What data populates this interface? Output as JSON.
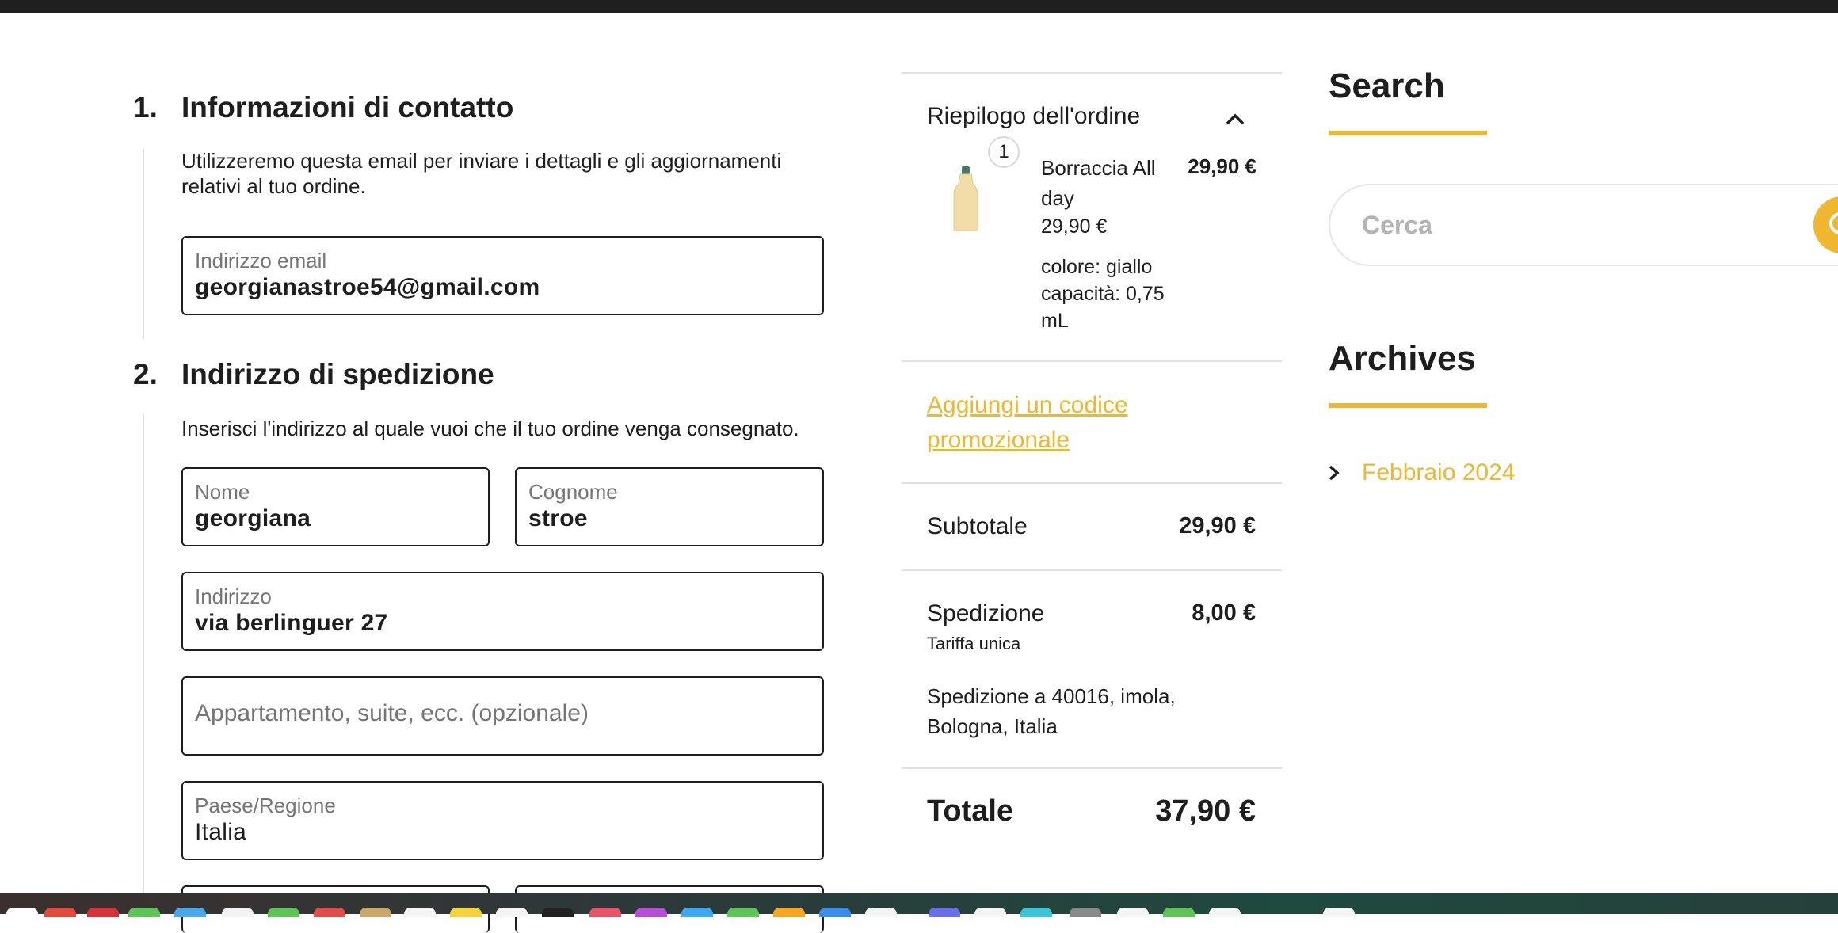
{
  "checkout": {
    "step1": {
      "number": "1.",
      "title": "Informazioni di contatto",
      "description": "Utilizzeremo questa email per inviare i dettagli e gli aggiornamenti relativi al tuo ordine.",
      "email": {
        "label": "Indirizzo email",
        "value": "georgianastroe54@gmail.com"
      }
    },
    "step2": {
      "number": "2.",
      "title": "Indirizzo di spedizione",
      "description": "Inserisci l'indirizzo al quale vuoi che il tuo ordine venga consegnato.",
      "first_name": {
        "label": "Nome",
        "value": "georgiana"
      },
      "last_name": {
        "label": "Cognome",
        "value": "stroe"
      },
      "address": {
        "label": "Indirizzo",
        "value": "via berlinguer 27"
      },
      "address2": {
        "placeholder": "Appartamento, suite, ecc. (opzionale)"
      },
      "country": {
        "label": "Paese/Regione",
        "value": "Italia"
      }
    }
  },
  "summary": {
    "heading": "Riepilogo dell'ordine",
    "item": {
      "quantity": "1",
      "name": "Borraccia All day",
      "line_total": "29,90 €",
      "unit_price": "29,90 €",
      "color": "colore: giallo",
      "capacity": "capacità: 0,75 mL",
      "thumb_color": "#f2dca8"
    },
    "promo_link": "Aggiungi un codice promozionale",
    "subtotal": {
      "label": "Subtotale",
      "value": "29,90 €"
    },
    "shipping": {
      "label": "Spedizione",
      "value": "8,00 €",
      "rate": "Tariffa unica",
      "destination": "Spedizione a 40016, imola, Bologna, Italia"
    },
    "total": {
      "label": "Totale",
      "value": "37,90 €"
    }
  },
  "sidebar": {
    "search": {
      "title": "Search",
      "placeholder": "Cerca"
    },
    "archives": {
      "title": "Archives",
      "items": [
        "Febbraio 2024"
      ]
    }
  },
  "colors": {
    "accent": "#efb72f",
    "text": "#1e1e1e",
    "muted": "#757575",
    "divider": "#e0e0e0"
  }
}
